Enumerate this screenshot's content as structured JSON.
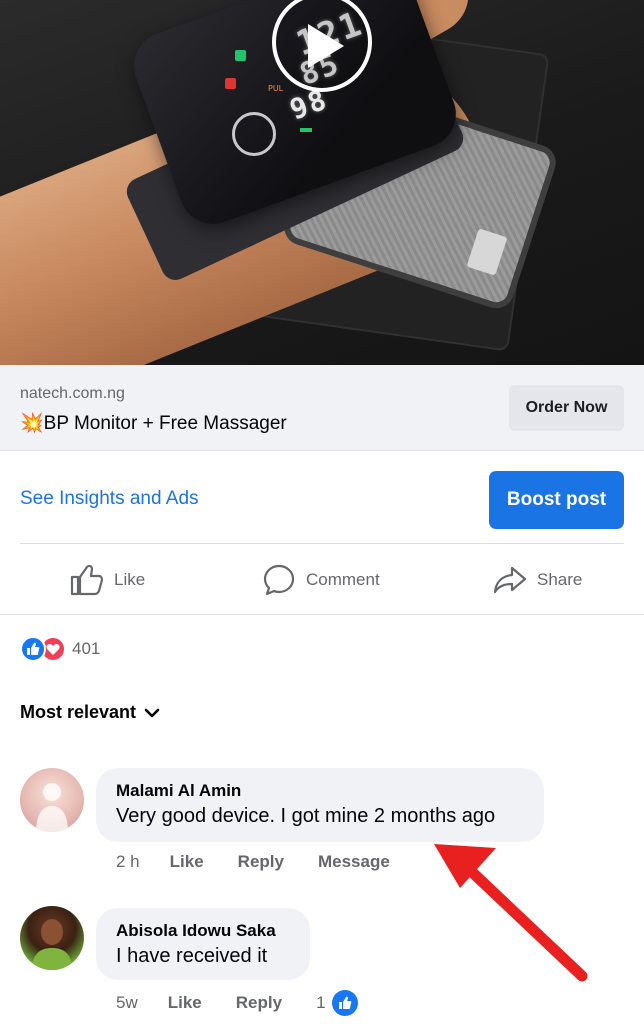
{
  "link_preview": {
    "domain": "natech.com.ng",
    "emoji": "💥",
    "title": "BP Monitor + Free Massager",
    "cta_label": "Order Now"
  },
  "insights": {
    "link_label": "See Insights and Ads",
    "boost_label": "Boost post"
  },
  "actions": {
    "like_label": "Like",
    "comment_label": "Comment",
    "share_label": "Share"
  },
  "reactions": {
    "count": "401",
    "types": [
      "like",
      "love"
    ]
  },
  "sort": {
    "label": "Most relevant"
  },
  "comments": [
    {
      "name": "Malami Al Amin",
      "text": "Very good device. I got mine 2 months ago",
      "time": "2 h",
      "like_label": "Like",
      "reply_label": "Reply",
      "message_label": "Message"
    },
    {
      "name": "Abisola Idowu Saka",
      "text": "I have received it",
      "time": "5w",
      "like_label": "Like",
      "reply_label": "Reply",
      "like_count": "1"
    }
  ],
  "device_display": {
    "line1": "121",
    "line2": "85",
    "line3": "98",
    "pulse_label": "PUL"
  },
  "colors": {
    "accent": "#1b74e4",
    "annotation": "#e8201f",
    "love": "#f33e58"
  }
}
